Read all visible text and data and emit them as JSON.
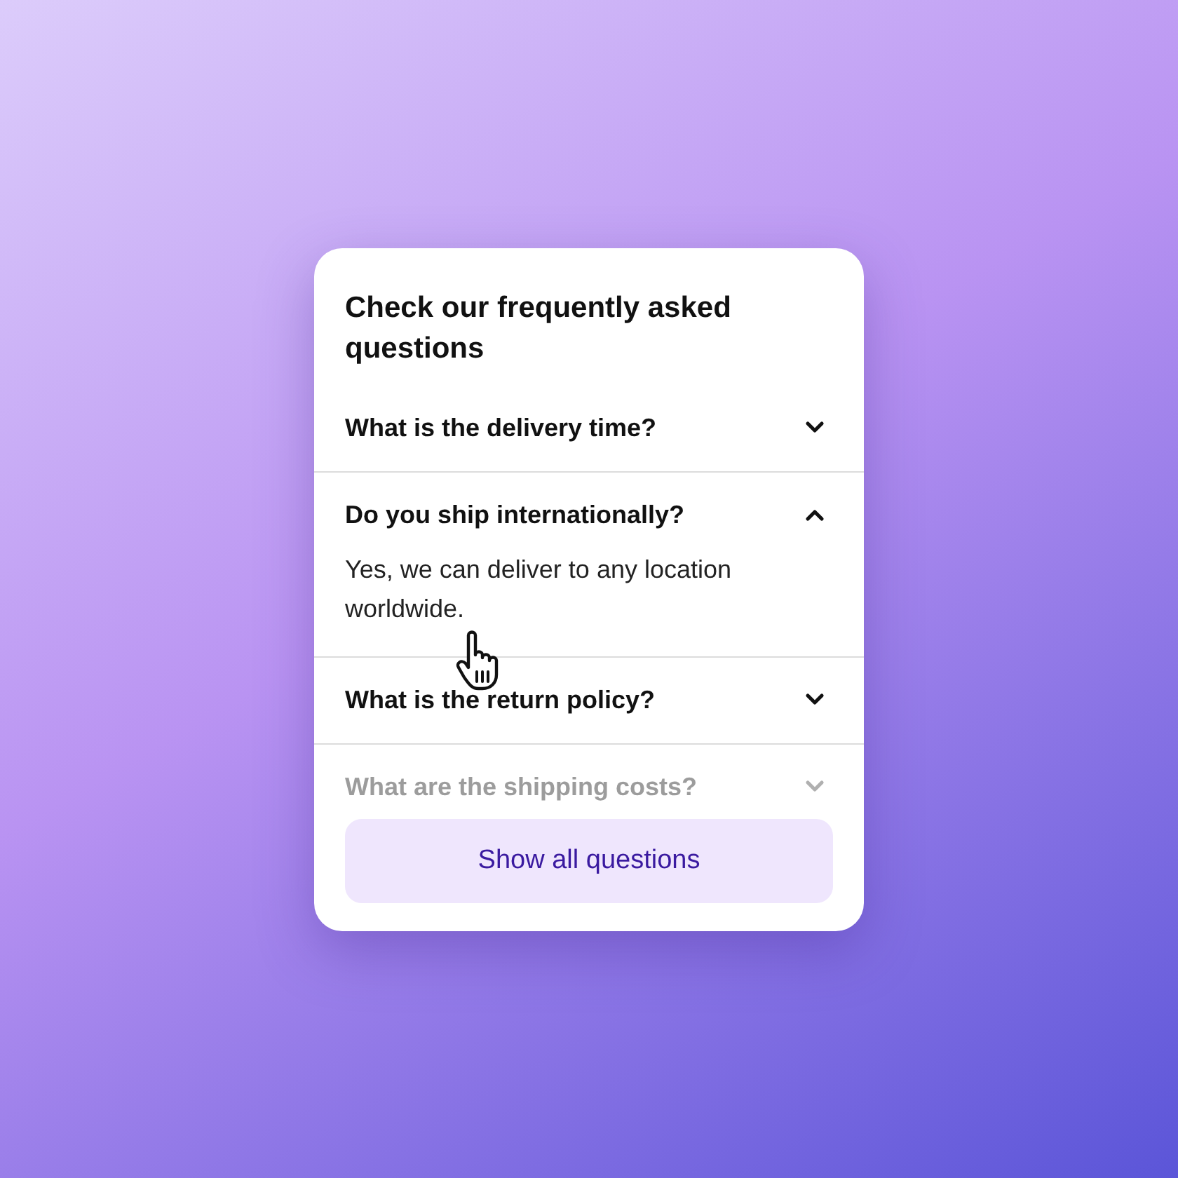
{
  "card": {
    "title": "Check our frequently asked questions",
    "faq_items": [
      {
        "question": "What is the delivery time?",
        "expanded": false,
        "dimmed": false
      },
      {
        "question": "Do you ship internationally?",
        "expanded": true,
        "dimmed": false,
        "answer": "Yes, we can deliver to any location worldwide."
      },
      {
        "question": "What is the return policy?",
        "expanded": false,
        "dimmed": false
      },
      {
        "question": "What are the shipping costs?",
        "expanded": false,
        "dimmed": true
      }
    ],
    "button": "Show all questions"
  }
}
